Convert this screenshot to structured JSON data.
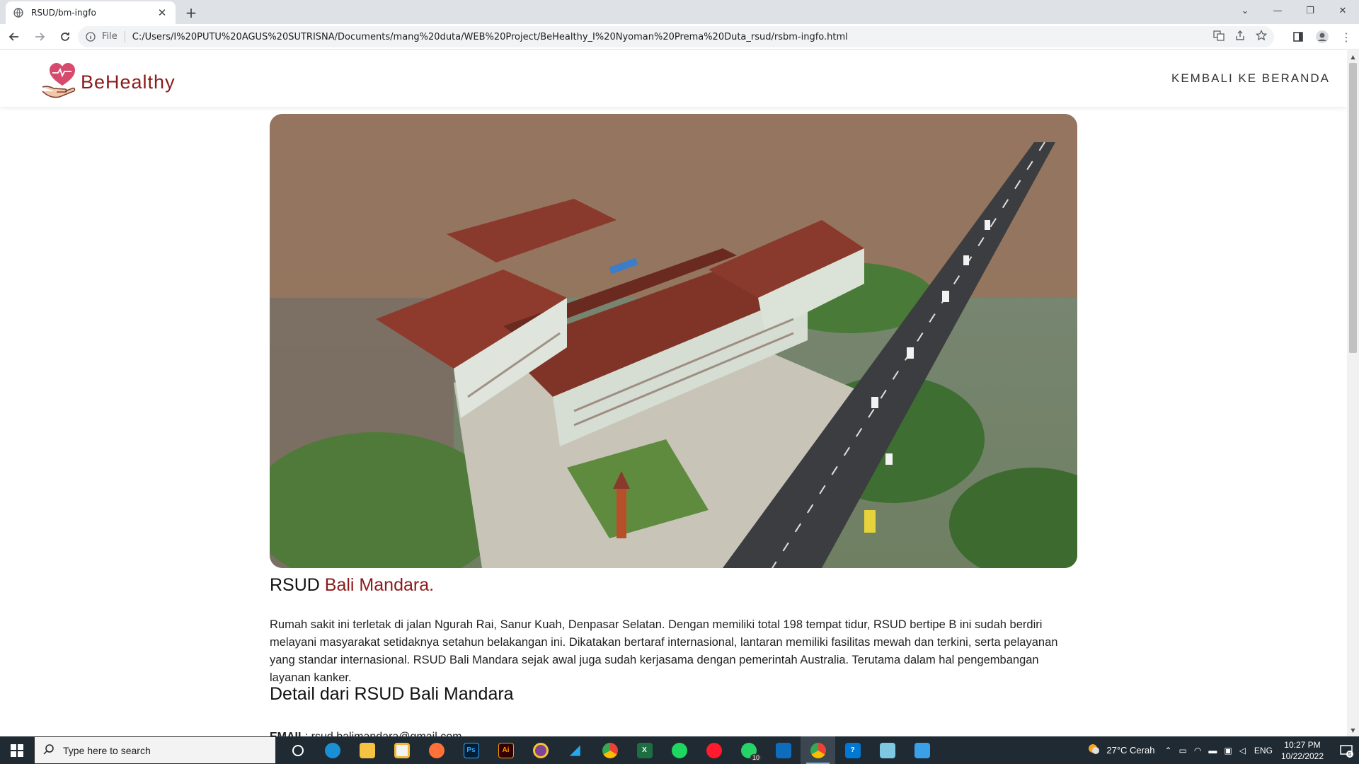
{
  "browser": {
    "tab_title": "RSUD/bm-ingfo",
    "file_label": "File",
    "url": "C:/Users/I%20PUTU%20AGUS%20SUTRISNA/Documents/mang%20duta/WEB%20Project/BeHealthy_I%20Nyoman%20Prema%20Duta_rsud/rsbm-ingfo.html"
  },
  "site": {
    "logo_be": "Be",
    "logo_healthy": "Healthy",
    "nav_back": "KEMBALI KE BERANDA"
  },
  "content": {
    "title_prefix": "RSUD ",
    "title_accent": "Bali Mandara.",
    "description": "Rumah sakit ini terletak di jalan Ngurah Rai, Sanur Kuah, Denpasar Selatan. Dengan memiliki total 198 tempat tidur, RSUD bertipe B ini sudah berdiri melayani masyarakat setidaknya setahun belakangan ini. Dikatakan bertaraf internasional, lantaran memiliki fasilitas mewah dan terkini, serta pelayanan yang standar internasional. RSUD Bali Mandara sejak awal juga sudah kerjasama dengan pemerintah Australia. Terutama dalam hal pengembangan layanan kanker.",
    "detail_heading": "Detail dari RSUD Bali Mandara",
    "email_label": "EMAIL",
    "email_value": ": rsud.balimandara@gmail.com"
  },
  "taskbar": {
    "search_placeholder": "Type here to search",
    "whatsapp_badge": "10",
    "weather": "27°C  Cerah",
    "lang": "ENG",
    "time": "10:27 PM",
    "date": "10/22/2022",
    "notif_count": "5"
  },
  "colors": {
    "accent": "#8b1a1a",
    "taskbar": "#1f2a33"
  }
}
